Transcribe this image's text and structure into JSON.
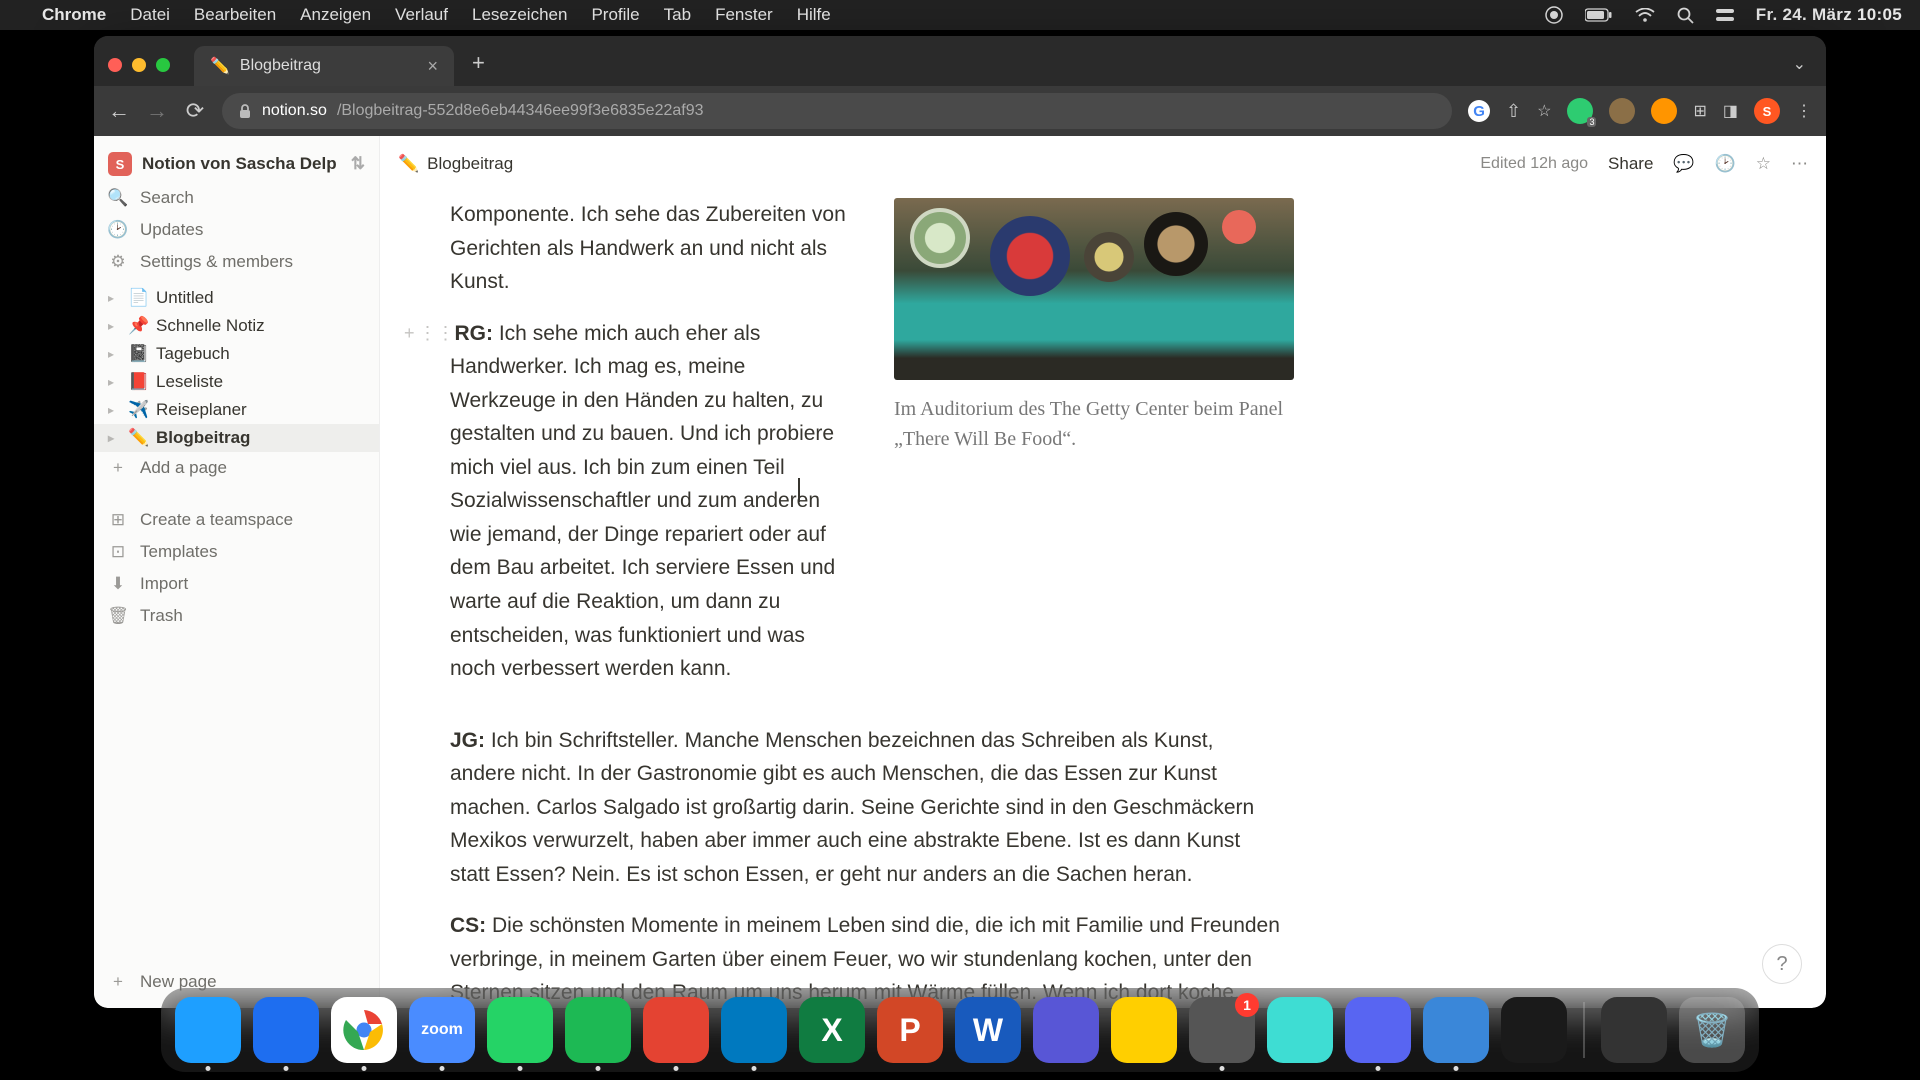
{
  "menubar": {
    "app": "Chrome",
    "items": [
      "Datei",
      "Bearbeiten",
      "Anzeigen",
      "Verlauf",
      "Lesezeichen",
      "Profile",
      "Tab",
      "Fenster",
      "Hilfe"
    ],
    "clock": "Fr. 24. März  10:05"
  },
  "browser": {
    "tab_title": "Blogbeitrag",
    "tab_emoji": "✏️",
    "url_host": "notion.so",
    "url_path": "/Blogbeitrag-552d8e6eb44346ee99f3e6835e22af93"
  },
  "notion": {
    "workspace": "Notion von Sascha Delp",
    "workspace_initial": "S",
    "nav": {
      "search": "Search",
      "updates": "Updates",
      "settings": "Settings & members"
    },
    "pages": [
      {
        "emoji": "📄",
        "title": "Untitled",
        "active": false
      },
      {
        "emoji": "📌",
        "title": "Schnelle Notiz",
        "active": false
      },
      {
        "emoji": "📓",
        "title": "Tagebuch",
        "active": false
      },
      {
        "emoji": "📕",
        "title": "Leseliste",
        "active": false
      },
      {
        "emoji": "✈️",
        "title": "Reiseplaner",
        "active": false
      },
      {
        "emoji": "✏️",
        "title": "Blogbeitrag",
        "active": true
      }
    ],
    "add_page": "Add a page",
    "footer": {
      "teamspace": "Create a teamspace",
      "templates": "Templates",
      "import": "Import",
      "trash": "Trash"
    },
    "new_page": "New page",
    "header": {
      "crumb_emoji": "✏️",
      "crumb_title": "Blogbeitrag",
      "edited": "Edited 12h ago",
      "share": "Share"
    },
    "content": {
      "p1": "Komponente. Ich sehe das Zubereiten von Gerichten als Handwerk an und nicht als Kunst.",
      "p2_speaker": "RG:",
      "p2": " Ich sehe mich auch eher als Handwerker. Ich mag es, meine Werkzeuge in den Händen zu halten, zu gestalten und zu bauen. Und ich probiere mich viel aus. Ich bin zum einen Teil Sozialwissenschaftler und zum anderen wie jemand, der Dinge repariert oder auf dem Bau arbeitet. Ich serviere Essen und warte auf die Reaktion, um dann zu entscheiden, was funktioniert und was noch verbessert werden kann.",
      "caption": "Im Auditorium des The Getty Center beim Panel „There Will Be Food“.",
      "p3_speaker": "JG:",
      "p3": " Ich bin Schriftsteller. Manche Menschen bezeichnen das Schreiben als Kunst, andere nicht. In der Gastronomie gibt es auch Menschen, die das Essen zur Kunst machen. Carlos Salgado ist großartig darin. Seine Gerichte sind in den Geschmäckern Mexikos verwurzelt, haben aber immer auch eine abstrakte Ebene. Ist es dann Kunst statt Essen? Nein. Es ist schon Essen, er geht nur anders an die Sachen heran.",
      "p4_speaker": "CS:",
      "p4": " Die schönsten Momente in meinem Leben sind die, die ich mit Familie und Freunden verbringe, in meinem Garten über einem Feuer, wo wir stundenlang kochen, unter den Sternen sitzen und den Raum um uns herum mit Wärme füllen. Wenn ich dort koche, fühle ich mich weitaus mehr wie ein Künstler als in sämtlichen Sternerestaurants, in denen ich gearbeitet habe."
    }
  },
  "dock": {
    "apps": [
      {
        "name": "finder",
        "color": "#1e9fff"
      },
      {
        "name": "safari",
        "color": "#1e6ef0"
      },
      {
        "name": "chrome",
        "color": "#fff"
      },
      {
        "name": "zoom",
        "color": "#4a8cff"
      },
      {
        "name": "whatsapp",
        "color": "#25d366"
      },
      {
        "name": "spotify",
        "color": "#1db954"
      },
      {
        "name": "todoist",
        "color": "#e44332"
      },
      {
        "name": "trello",
        "color": "#0079bf"
      },
      {
        "name": "excel",
        "color": "#107c41"
      },
      {
        "name": "powerpoint",
        "color": "#d24726"
      },
      {
        "name": "word",
        "color": "#185abd"
      },
      {
        "name": "imovie",
        "color": "#5856d6"
      },
      {
        "name": "drive",
        "color": "#ffcf00"
      },
      {
        "name": "settings",
        "color": "#555",
        "badge": "1"
      },
      {
        "name": "app1",
        "color": "#3eddd3"
      },
      {
        "name": "discord",
        "color": "#5865f2"
      },
      {
        "name": "quicktime",
        "color": "#3a87d9"
      },
      {
        "name": "voice",
        "color": "#1a1a1a"
      }
    ]
  }
}
